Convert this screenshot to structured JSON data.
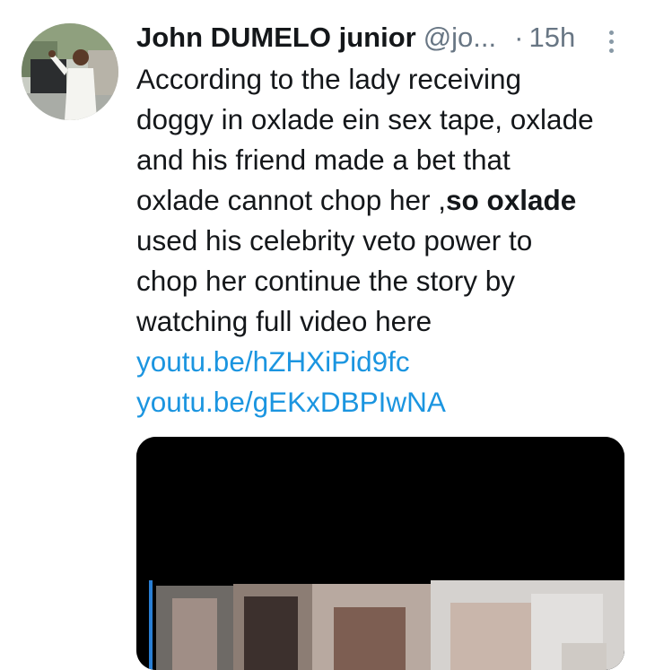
{
  "tweet": {
    "display_name": "John DUMELO junior",
    "handle": "@jo...",
    "separator": "·",
    "time": "15h",
    "more_icon": "more-vertical-icon",
    "text_lines": [
      "According to the lady receiving",
      "doggy in oxlade ein sex tape, oxlade",
      "and his friend made a bet that"
    ],
    "text_line4_plain": "oxlade cannot chop her ,",
    "text_line4_bold": "so oxlade",
    "text_lines_after": [
      "used his celebrity veto power to",
      "chop her continue the story by",
      "watching full video here"
    ],
    "links": [
      "youtu.be/hZHXiPid9fc",
      "youtu.be/gEKxDBPIwNA"
    ],
    "colors": {
      "link": "#1b95e0",
      "secondary": "#687684",
      "text": "#14171a"
    }
  }
}
